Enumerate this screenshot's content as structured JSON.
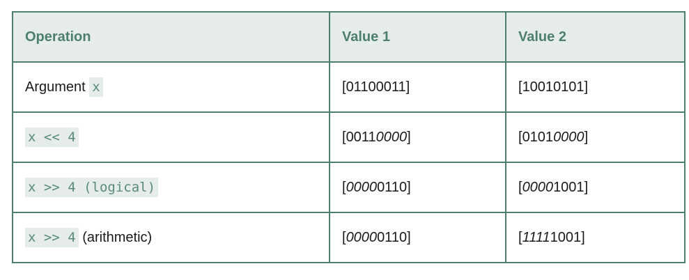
{
  "table": {
    "headers": [
      "Operation",
      "Value 1",
      "Value 2"
    ],
    "rows": [
      {
        "op_code": "x",
        "op_prefix": "Argument ",
        "op_suffix": "",
        "v1": {
          "open": "[",
          "italic": "",
          "plain": "01100011",
          "close": "]"
        },
        "v2": {
          "open": "[",
          "italic": "",
          "plain": "10010101",
          "close": "]"
        }
      },
      {
        "op_code": "x << 4",
        "op_prefix": "",
        "op_suffix": "",
        "v1": {
          "open": "[",
          "plain": "0011",
          "italic": "0000",
          "close": "]"
        },
        "v2": {
          "open": "[",
          "plain": "0101",
          "italic": "0000",
          "close": "]"
        }
      },
      {
        "op_code": "x >> 4 (logical)",
        "op_prefix": "",
        "op_suffix": "",
        "v1": {
          "open": "[",
          "italic": "0000",
          "plain": "0110",
          "close": "]"
        },
        "v2": {
          "open": "[",
          "italic": "0000",
          "plain": "1001",
          "close": "]"
        }
      },
      {
        "op_code": "x >> 4",
        "op_prefix": "",
        "op_suffix": " (arithmetic)",
        "v1": {
          "open": "[",
          "italic": "0000",
          "plain": "0110",
          "close": "]"
        },
        "v2": {
          "open": "[",
          "italic": "1111",
          "plain": "1001",
          "close": "]"
        }
      }
    ]
  }
}
